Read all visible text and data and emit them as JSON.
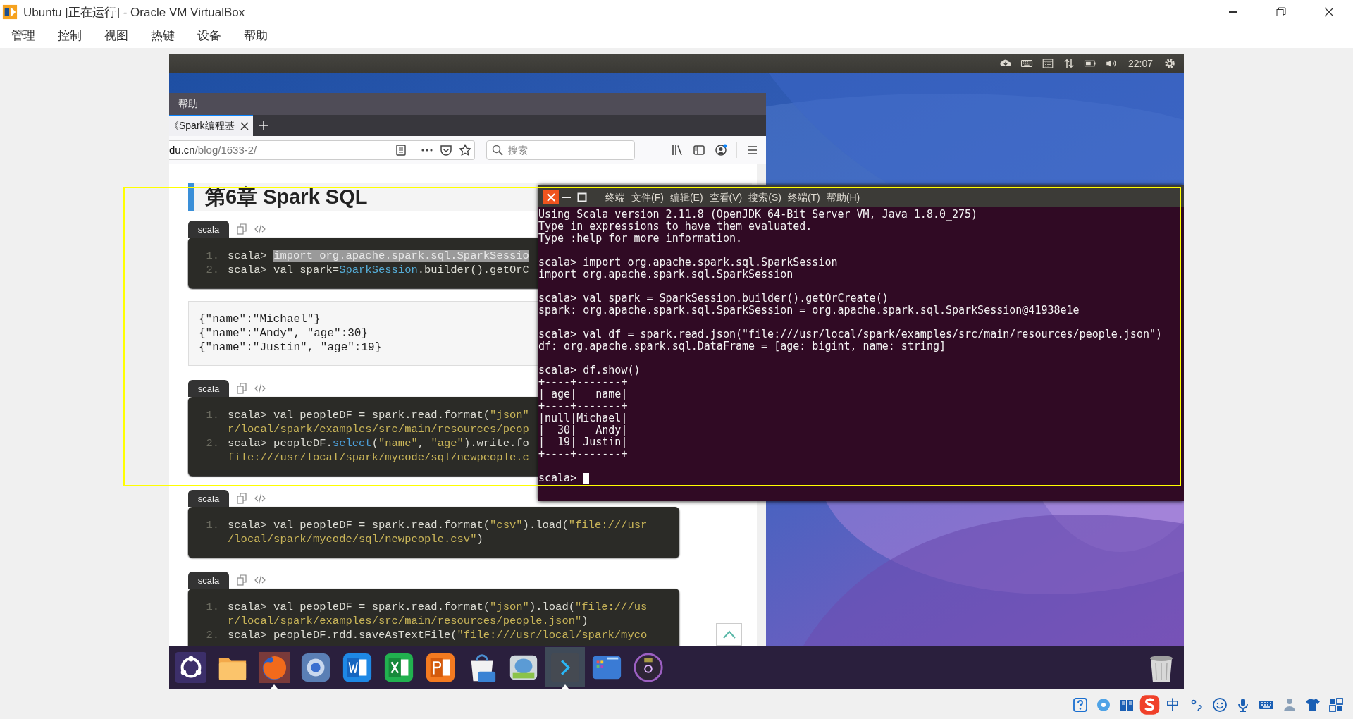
{
  "window": {
    "title": "Ubuntu [正在运行] - Oracle VM VirtualBox"
  },
  "menu": [
    "管理",
    "控制",
    "视图",
    "热键",
    "设备",
    "帮助"
  ],
  "top_panel": {
    "indicators": [
      {
        "kind": "cloud"
      },
      {
        "kind": "keyboard"
      },
      {
        "kind": "calendar"
      },
      {
        "kind": "network"
      },
      {
        "kind": "battery"
      },
      {
        "kind": "volume"
      }
    ],
    "time": "22:07"
  },
  "browser": {
    "menu": [
      "帮助"
    ],
    "tabs": [
      {
        "label": "《Spark编程基",
        "selected": true
      }
    ],
    "url": {
      "host": "du.cn",
      "path": "/blog/1633-2/"
    },
    "search": {
      "placeholder": "搜索"
    },
    "page": {
      "heading": "第6章 Spark SQL",
      "blocks": [
        {
          "kind": "code",
          "tab": "scala",
          "lines": [
            {
              "number": "1.",
              "tokens": [
                {
                  "text": "scala> ",
                  "kind": "plain"
                },
                {
                  "text": "import org.apache.spark.sql.SparkSessio",
                  "kind": "selected"
                }
              ]
            },
            {
              "number": "2.",
              "tokens": [
                {
                  "text": "scala> val spark=",
                  "kind": "plain"
                },
                {
                  "text": "SparkSession",
                  "kind": "type"
                },
                {
                  "text": ".builder().getOrC",
                  "kind": "plain"
                }
              ]
            }
          ]
        },
        {
          "kind": "json",
          "lines": [
            "{\"name\":\"Michael\"}",
            "{\"name\":\"Andy\", \"age\":30}",
            "{\"name\":\"Justin\", \"age\":19}"
          ]
        },
        {
          "kind": "code",
          "tab": "scala",
          "lines": [
            {
              "number": "1.",
              "tokens": [
                {
                  "text": "scala> val peopleDF = spark.read.format(",
                  "kind": "plain"
                },
                {
                  "text": "\"json\"",
                  "kind": "string"
                }
              ]
            },
            {
              "tokens": [
                {
                  "text": "r/local/spark/examples/src/main/resources/peop",
                  "kind": "string"
                }
              ]
            },
            {
              "number": "2.",
              "tokens": [
                {
                  "text": "scala> peopleDF.",
                  "kind": "plain"
                },
                {
                  "text": "select",
                  "kind": "method"
                },
                {
                  "text": "(",
                  "kind": "plain"
                },
                {
                  "text": "\"name\"",
                  "kind": "string"
                },
                {
                  "text": ", ",
                  "kind": "plain"
                },
                {
                  "text": "\"age\"",
                  "kind": "string"
                },
                {
                  "text": ").write.fo",
                  "kind": "plain"
                }
              ]
            },
            {
              "tokens": [
                {
                  "text": "file:///usr/local/spark/mycode/sql/newpeople.c",
                  "kind": "string"
                }
              ]
            }
          ]
        },
        {
          "kind": "code",
          "tab": "scala",
          "lines": [
            {
              "number": "1.",
              "tokens": [
                {
                  "text": "scala> val peopleDF = spark.read.format(",
                  "kind": "plain"
                },
                {
                  "text": "\"csv\"",
                  "kind": "string"
                },
                {
                  "text": ").load(",
                  "kind": "plain"
                },
                {
                  "text": "\"file:///usr",
                  "kind": "string"
                }
              ]
            },
            {
              "tokens": [
                {
                  "text": "/local/spark/mycode/sql/newpeople.csv\"",
                  "kind": "string"
                },
                {
                  "text": ")",
                  "kind": "plain"
                }
              ]
            }
          ]
        },
        {
          "kind": "code",
          "tab": "scala",
          "lines": [
            {
              "number": "1.",
              "tokens": [
                {
                  "text": "scala> val peopleDF = spark.read.format(",
                  "kind": "plain"
                },
                {
                  "text": "\"json\"",
                  "kind": "string"
                },
                {
                  "text": ").load(",
                  "kind": "plain"
                },
                {
                  "text": "\"file:///us",
                  "kind": "string"
                }
              ]
            },
            {
              "tokens": [
                {
                  "text": "r/local/spark/examples/src/main/resources/people.json\"",
                  "kind": "string"
                },
                {
                  "text": ")",
                  "kind": "plain"
                }
              ]
            },
            {
              "number": "2.",
              "tokens": [
                {
                  "text": "scala> peopleDF.rdd.saveAsTextFile(",
                  "kind": "plain"
                },
                {
                  "text": "\"file:///usr/local/spark/myco",
                  "kind": "string"
                }
              ]
            }
          ]
        }
      ]
    }
  },
  "terminal": {
    "menu": [
      "终端",
      "文件(F)",
      "编辑(E)",
      "查看(V)",
      "搜索(S)",
      "终端(T)",
      "帮助(H)"
    ],
    "groups": [
      [
        "Using Scala version 2.11.8 (OpenJDK 64-Bit Server VM, Java 1.8.0_275)",
        "Type in expressions to have them evaluated.",
        "Type :help for more information."
      ],
      [
        "scala> import org.apache.spark.sql.SparkSession",
        "import org.apache.spark.sql.SparkSession"
      ],
      [
        "scala> val spark = SparkSession.builder().getOrCreate()",
        "spark: org.apache.spark.sql.SparkSession = org.apache.spark.sql.SparkSession@41938e1e"
      ],
      [
        "scala> val df = spark.read.json(\"file:///usr/local/spark/examples/src/main/resources/people.json\")",
        "df: org.apache.spark.sql.DataFrame = [age: bigint, name: string]"
      ],
      [
        "scala> df.show()",
        "+----+-------+",
        "| age|   name|",
        "+----+-------+",
        "|null|Michael|",
        "|  30|   Andy|",
        "|  19| Justin|",
        "+----+-------+"
      ]
    ],
    "prompt": "scala>"
  },
  "dock": {
    "items": [
      {
        "kind": "dash",
        "running": false,
        "selected": false
      },
      {
        "kind": "files",
        "running": false,
        "selected": false
      },
      {
        "kind": "firefox",
        "running": true,
        "selected": false
      },
      {
        "kind": "browser",
        "running": false,
        "selected": false
      },
      {
        "kind": "writer",
        "running": false,
        "selected": false
      },
      {
        "kind": "spreadsheet",
        "running": false,
        "selected": false
      },
      {
        "kind": "slides",
        "running": false,
        "selected": false
      },
      {
        "kind": "store",
        "running": false,
        "selected": false
      },
      {
        "kind": "messenger",
        "running": false,
        "selected": false
      },
      {
        "kind": "terminal",
        "running": true,
        "selected": true
      },
      {
        "kind": "workspaces",
        "running": false,
        "selected": false
      },
      {
        "kind": "media",
        "running": false,
        "selected": false
      }
    ]
  },
  "tray": {
    "items": [
      {
        "kind": "help"
      },
      {
        "kind": "disc"
      },
      {
        "kind": "book"
      },
      {
        "kind": "sogou"
      },
      {
        "kind": "text",
        "label": "中"
      },
      {
        "kind": "punct"
      },
      {
        "kind": "smiley"
      },
      {
        "kind": "mic"
      },
      {
        "kind": "keyboard"
      },
      {
        "kind": "person"
      },
      {
        "kind": "shirt"
      },
      {
        "kind": "grid"
      }
    ]
  }
}
